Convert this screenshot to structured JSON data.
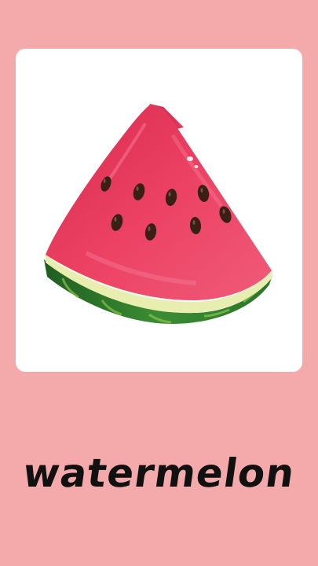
{
  "flashcard": {
    "word": "watermelon",
    "image_subject": "watermelon-slice",
    "colors": {
      "background": "#f4aaab",
      "card": "#ffffff",
      "text": "#111111",
      "flesh": "#e83a5c",
      "rind_light": "#e8eeb0",
      "rind_dark": "#2f7d2c",
      "seed": "#3a1f17"
    }
  }
}
